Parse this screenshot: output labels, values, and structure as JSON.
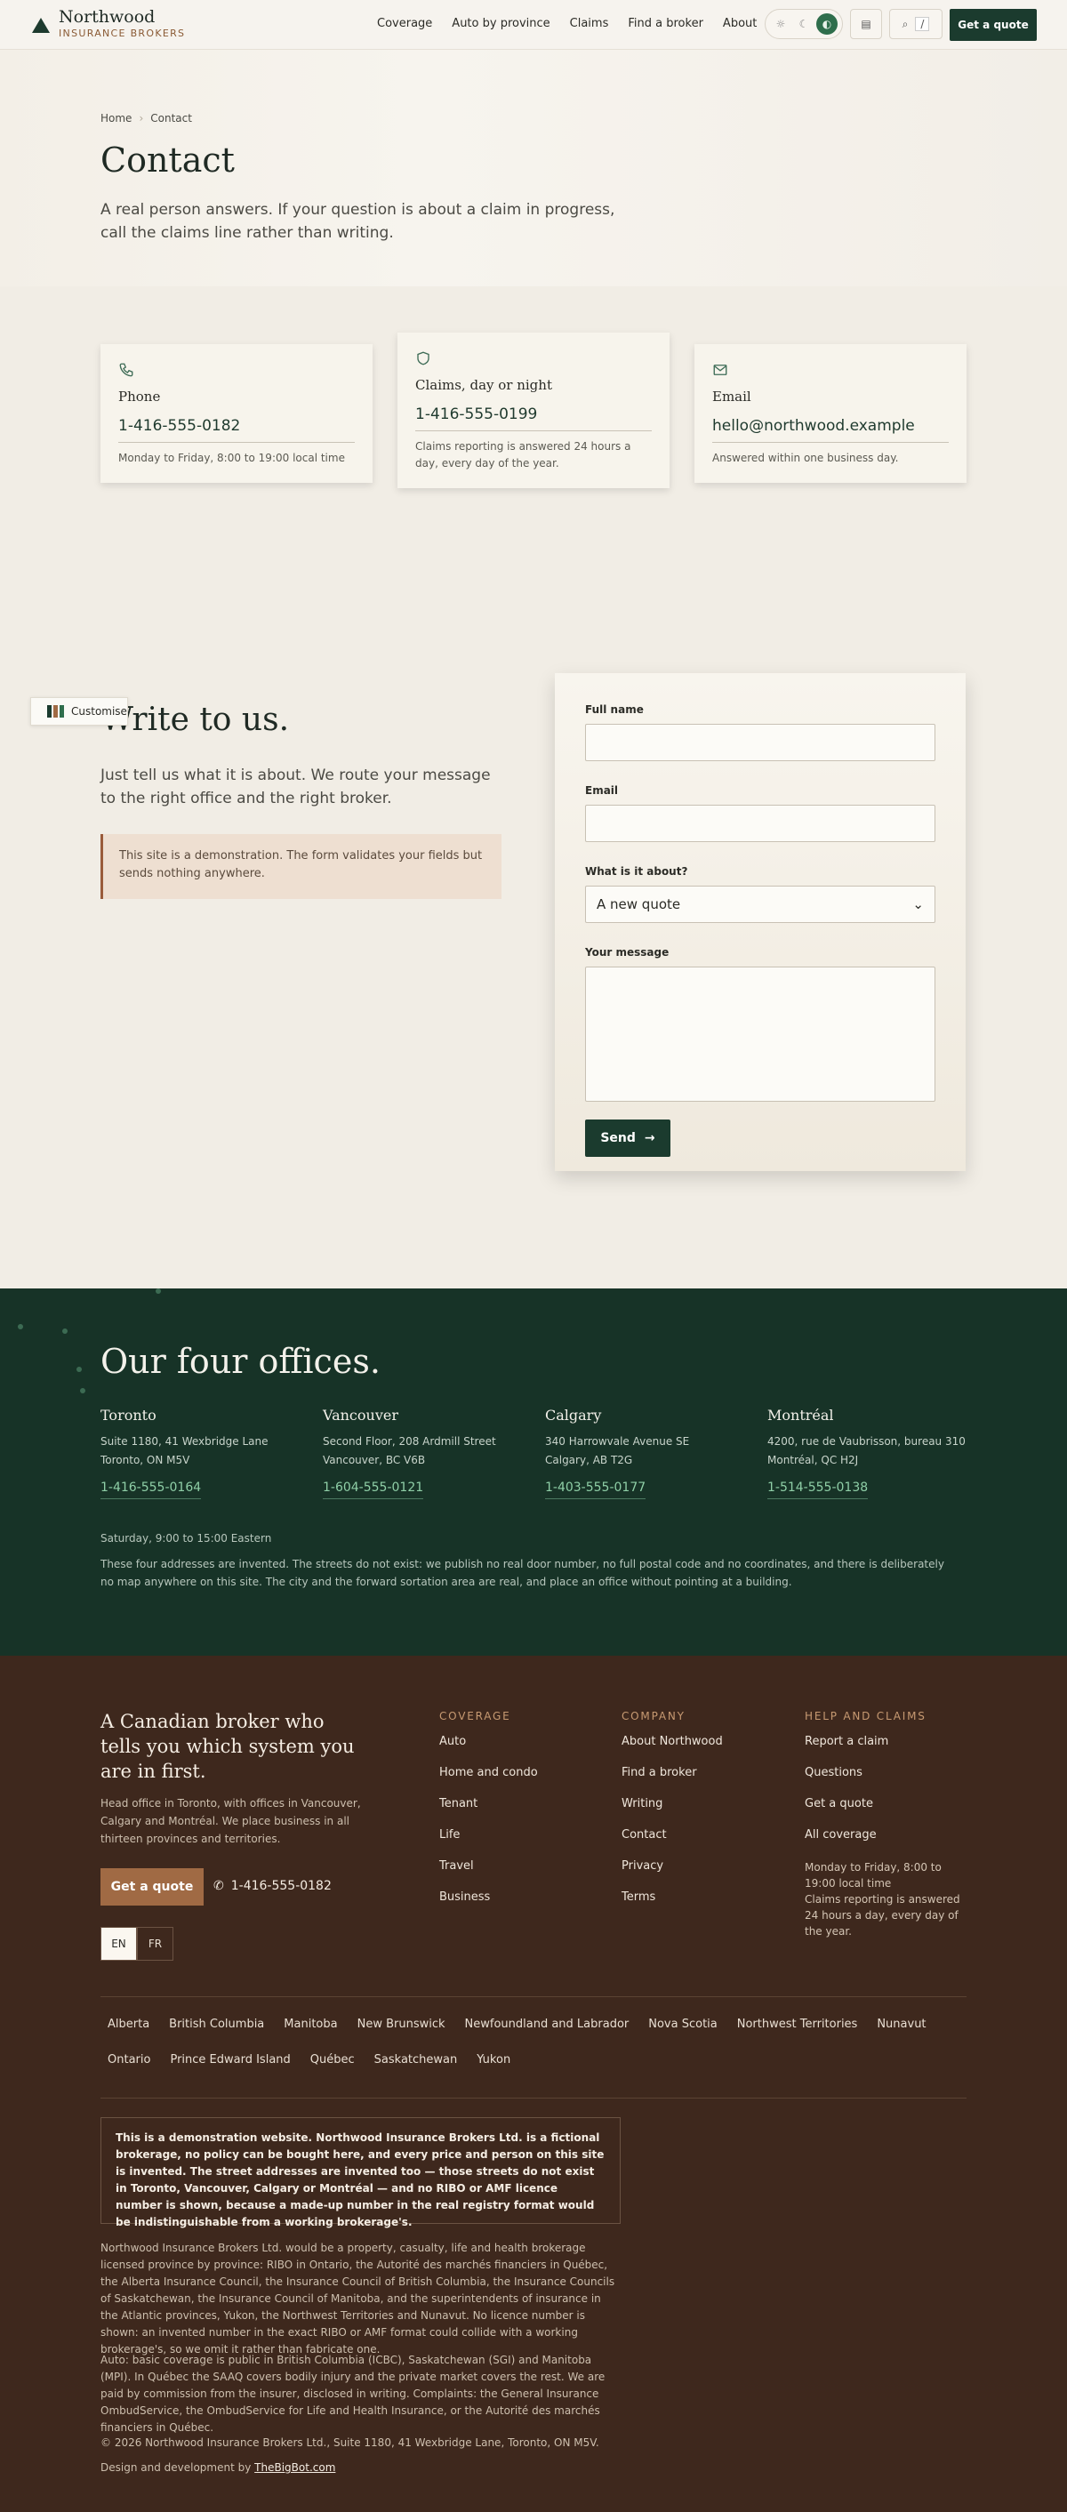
{
  "header": {
    "brand_name": "Northwood",
    "brand_sub": "INSURANCE BROKERS",
    "nav": [
      "Coverage",
      "Auto by province",
      "Claims",
      "Find a broker",
      "About"
    ],
    "search_kbd": "/",
    "cta": "Get a quote"
  },
  "hero": {
    "breadcrumb": [
      "Home",
      "Contact"
    ],
    "title": "Contact",
    "lede": "A real person answers. If your question is about a claim in progress, call the claims line rather than writing."
  },
  "cards": [
    {
      "icon": "phone-icon",
      "title": "Phone",
      "value": "1-416-555-0182",
      "note": "Monday to Friday, 8:00 to 19:00 local time"
    },
    {
      "icon": "shield-icon",
      "title": "Claims, day or night",
      "value": "1-416-555-0199",
      "note": "Claims reporting is answered 24 hours a day, every day of the year."
    },
    {
      "icon": "mail-icon",
      "title": "Email",
      "value": "hello@northwood.example",
      "note": "Answered within one business day."
    }
  ],
  "customise": {
    "label": "Customise"
  },
  "write": {
    "title": "Write to us.",
    "lede": "Just tell us what it is about. We route your message to the right office and the right broker.",
    "demo_note": "This site is a demonstration. The form validates your fields but sends nothing anywhere."
  },
  "form": {
    "name_label": "Full name",
    "email_label": "Email",
    "topic_label": "What is it about?",
    "topic_value": "A new quote",
    "message_label": "Your message",
    "send_label": "Send"
  },
  "offices": {
    "title": "Our four offices.",
    "list": [
      {
        "city": "Toronto",
        "addr1": "Suite 1180, 41 Wexbridge Lane",
        "addr2": "Toronto, ON M5V",
        "phone": "1-416-555-0164"
      },
      {
        "city": "Vancouver",
        "addr1": "Second Floor, 208 Ardmill Street",
        "addr2": "Vancouver, BC V6B",
        "phone": "1-604-555-0121"
      },
      {
        "city": "Calgary",
        "addr1": "340 Harrowvale Avenue SE",
        "addr2": "Calgary, AB T2G",
        "phone": "1-403-555-0177"
      },
      {
        "city": "Montréal",
        "addr1": "4200, rue de Vaubrisson, bureau 310",
        "addr2": "Montréal, QC H2J",
        "phone": "1-514-555-0138"
      }
    ],
    "hours": "Saturday, 9:00 to 15:00 Eastern",
    "disclaimer": "These four addresses are invented. The streets do not exist: we publish no real door number, no full postal code and no coordinates, and there is deliberately no map anywhere on this site. The city and the forward sortation area are real, and place an office without pointing at a building."
  },
  "footer": {
    "tagline": "A Canadian broker who tells you which system you are in first.",
    "desc": "Head office in Toronto, with offices in Vancouver, Calgary and Montréal. We place business in all thirteen provinces and territories.",
    "cta": "Get a quote",
    "phone": "1-416-555-0182",
    "lang_en": "EN",
    "lang_fr": "FR",
    "coverage": {
      "heading": "COVERAGE",
      "links": [
        "Auto",
        "Home and condo",
        "Tenant",
        "Life",
        "Travel",
        "Business"
      ]
    },
    "company": {
      "heading": "COMPANY",
      "links": [
        "About Northwood",
        "Find a broker",
        "Writing",
        "Contact",
        "Privacy",
        "Terms"
      ]
    },
    "help": {
      "heading": "HELP AND CLAIMS",
      "links": [
        "Report a claim",
        "Questions",
        "Get a quote",
        "All coverage"
      ],
      "hours": "Monday to Friday, 8:00 to 19:00 local time",
      "claims": "Claims reporting is answered 24 hours a day, every day of the year."
    },
    "provinces": [
      "Alberta",
      "British Columbia",
      "Manitoba",
      "New Brunswick",
      "Newfoundland and Labrador",
      "Nova Scotia",
      "Northwest Territories",
      "Nunavut",
      "Ontario",
      "Prince Edward Island",
      "Québec",
      "Saskatchewan",
      "Yukon"
    ],
    "demo": "This is a demonstration website. Northwood Insurance Brokers Ltd. is a fictional brokerage, no policy can be bought here, and every price and person on this site is invented. The street addresses are invented too — those streets do not exist in Toronto, Vancouver, Calgary or Montréal — and no RIBO or AMF licence number is shown, because a made-up number in the real registry format would be indistinguishable from a working brokerage's.",
    "legal1": "Northwood Insurance Brokers Ltd. would be a property, casualty, life and health brokerage licensed province by province: RIBO in Ontario, the Autorité des marchés financiers in Québec, the Alberta Insurance Council, the Insurance Council of British Columbia, the Insurance Councils of Saskatchewan, the Insurance Council of Manitoba, and the superintendents of insurance in the Atlantic provinces, Yukon, the Northwest Territories and Nunavut. No licence number is shown: an invented number in the exact RIBO or AMF format could collide with a working brokerage's, so we omit it rather than fabricate one.",
    "legal2": "Auto: basic coverage is public in British Columbia (ICBC), Saskatchewan (SGI) and Manitoba (MPI). In Québec the SAAQ covers bodily injury and the private market covers the rest. We are paid by commission from the insurer, disclosed in writing. Complaints: the General Insurance OmbudService, the OmbudService for Life and Health Insurance, or the Autorité des marchés financiers in Québec.",
    "copyright": "© 2026 Northwood Insurance Brokers Ltd., Suite 1180, 41 Wexbridge Lane, Toronto, ON M5V.",
    "credit_prefix": "Design and development by",
    "credit_link": "TheBigBot.com"
  },
  "colors": {
    "forest": "#173327",
    "brown": "#3e281d",
    "cream": "#f1ede5",
    "accent_green": "#8fcfa7",
    "copper": "#a06a44"
  }
}
